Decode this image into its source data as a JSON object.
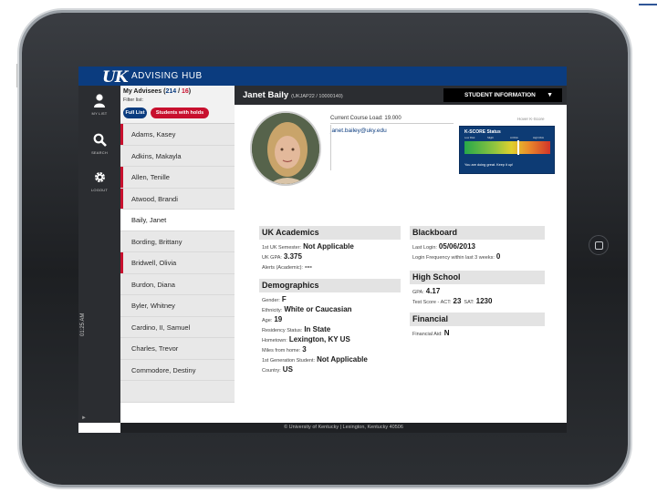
{
  "app": {
    "logo": "UK",
    "title": "ADVISING HUB",
    "clock": "01:25 AM",
    "footer": "© University of Kentucky | Lexington, Kentucky 40506"
  },
  "nav": {
    "my_list": "MY LIST",
    "search": "SEARCH",
    "logout": "LOGOUT"
  },
  "advisees": {
    "label": "My Advisees (",
    "total": "214",
    "sep": " / ",
    "holds": "16",
    "close": ")",
    "filter_label": "Filter list:",
    "full_list": "Full List",
    "students_with_holds": "Students with holds",
    "students": [
      {
        "name": "Adams, Kasey",
        "hold": true
      },
      {
        "name": "Adkins, Makayla",
        "hold": false
      },
      {
        "name": "Allen, Tenille",
        "hold": true
      },
      {
        "name": "Atwood, Brandi",
        "hold": true
      },
      {
        "name": "Baily, Janet",
        "hold": false,
        "selected": true
      },
      {
        "name": "Bording, Brittany",
        "hold": false
      },
      {
        "name": "Bridwell, Olivia",
        "hold": true
      },
      {
        "name": "Burdon, Diana",
        "hold": false
      },
      {
        "name": "Byler, Whitney",
        "hold": false
      },
      {
        "name": "Cardino, II, Samuel",
        "hold": false
      },
      {
        "name": "Charles, Trevor",
        "hold": false
      },
      {
        "name": "Commodore, Destiny",
        "hold": false
      },
      {
        "name": "",
        "hold": false
      }
    ]
  },
  "student": {
    "name": "Janet Baily",
    "id": "(UKJAP22 / 10000140)",
    "info_menu": "STUDENT INFORMATION",
    "course_load": "Current Course Load: 19.000",
    "email": "janet.bailey@uky.edu",
    "hover_note": "Hover K-Score",
    "kscore_title": "K-SCORE Status",
    "kscore_scale": [
      "Low Risk",
      "Slight",
      "At Risk",
      "High Risk"
    ],
    "kscore_level": 0.62,
    "kscore_text": "You are doing great. Keep it up!"
  },
  "uk_academics": {
    "title": "UK Academics",
    "fields": [
      {
        "label": "1st UK Semester:",
        "value": "Not Applicable"
      },
      {
        "label": "UK GPA:",
        "value": "3.375"
      },
      {
        "label": "Alerts (Academic):",
        "value": "---"
      }
    ]
  },
  "demographics": {
    "title": "Demographics",
    "fields": [
      {
        "label": "Gender:",
        "value": "F"
      },
      {
        "label": "Ethnicity:",
        "value": "White or Caucasian"
      },
      {
        "label": "Age:",
        "value": "19"
      },
      {
        "label": "Residency Status:",
        "value": "In State"
      },
      {
        "label": "Hometown:",
        "value": "Lexington, KY US"
      },
      {
        "label": "Miles from home:",
        "value": "3"
      },
      {
        "label": "1st Generation Student:",
        "value": "Not Applicable"
      },
      {
        "label": "Country:",
        "value": "US"
      }
    ]
  },
  "blackboard": {
    "title": "Blackboard",
    "fields": [
      {
        "label": "Last Login:",
        "value": "05/06/2013"
      },
      {
        "label": "Login Frequency within last 3 weeks:",
        "value": "0"
      }
    ]
  },
  "high_school": {
    "title": "High School",
    "fields": [
      {
        "label": "GPA:",
        "value": "4.17"
      },
      {
        "label": "Test Score - ACT:",
        "value": "23",
        "label2": "SAT:",
        "value2": "1230"
      }
    ]
  },
  "financial": {
    "title": "Financial",
    "fields": [
      {
        "label": "Financial Aid:",
        "value": "N"
      }
    ]
  },
  "colors": {
    "brand_blue": "#0b3c7f",
    "hold_red": "#c8102e",
    "dark_chrome": "#2b2d31"
  }
}
